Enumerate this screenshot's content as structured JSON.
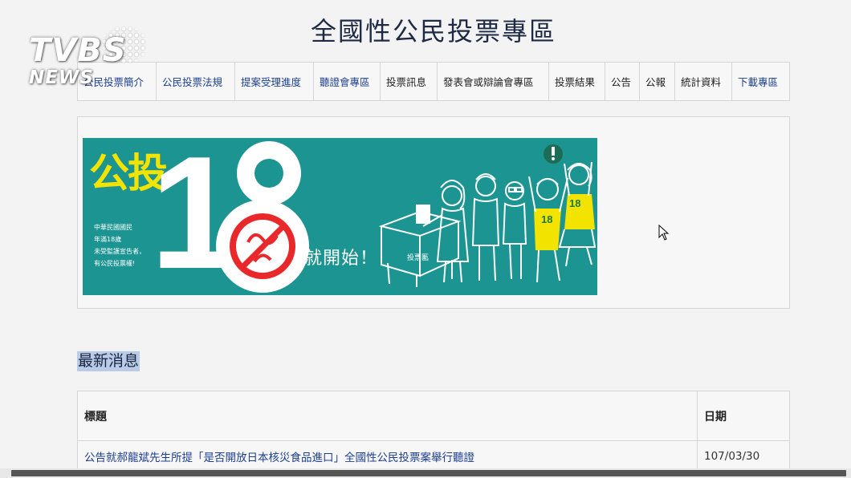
{
  "page": {
    "title": "全國性公民投票專區"
  },
  "watermark": {
    "top": "TVBS",
    "bottom": "NEWS"
  },
  "nav": {
    "items": [
      {
        "label": "公民投票簡介"
      },
      {
        "label": "公民投票法規"
      },
      {
        "label": "提案受理進度"
      },
      {
        "label": "聽證會專區"
      },
      {
        "label": "投票訊息"
      },
      {
        "label": "發表會或辯論會專區"
      },
      {
        "label": "投票結果"
      },
      {
        "label": "公告"
      },
      {
        "label": "公報"
      },
      {
        "label": "統計資料"
      },
      {
        "label": "下載專區"
      }
    ]
  },
  "banner": {
    "headline": "公投",
    "number_one": "1",
    "number_eight": "8",
    "eligibility_lines": [
      "中華民國國民",
      "年滿18歲",
      "未受監護宣告者，",
      "有公民投票權!"
    ],
    "tagline": "就開始！",
    "ballot_box_label": "投票匭",
    "shirt_number": "18",
    "colors": {
      "teal": "#1c9491",
      "yellow": "#f3e300",
      "red": "#e8282b"
    }
  },
  "news": {
    "heading": "最新消息",
    "columns": {
      "title": "標題",
      "date": "日期"
    },
    "rows": [
      {
        "title": "公告就郝龍斌先生所提「是否開放日本核災食品進口」全國性公民投票案舉行聽證",
        "date": "107/03/30"
      }
    ]
  }
}
